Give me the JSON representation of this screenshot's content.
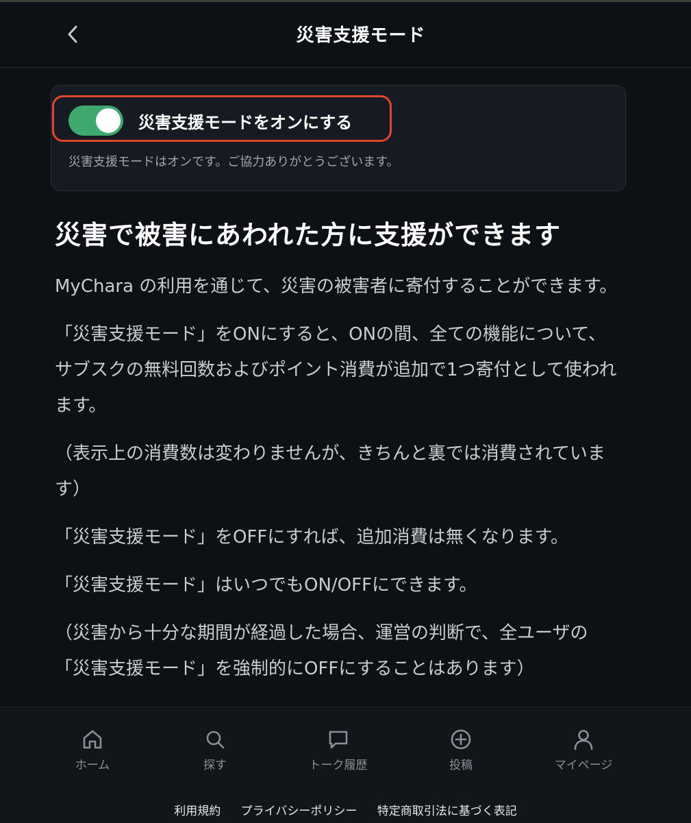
{
  "header": {
    "title": "災害支援モード",
    "back_icon": "chevron-left-icon"
  },
  "toggle_card": {
    "label": "災害支援モードをオンにする",
    "enabled": true,
    "status": "災害支援モードはオンです。ご協力ありがとうございます。",
    "switch_color": "#3ea86f",
    "highlight_color": "#e0452f"
  },
  "main": {
    "heading": "災害で被害にあわれた方に支援ができます",
    "paragraphs": [
      "MyChara の利用を通じて、災害の被害者に寄付することができます。",
      "「災害支援モード」をONにすると、ONの間、全ての機能について、サブスクの無料回数およびポイント消費が追加で1つ寄付として使われます。",
      "（表示上の消費数は変わりませんが、きちんと裏では消費されています）",
      "「災害支援モード」をOFFにすれば、追加消費は無くなります。",
      "「災害支援モード」はいつでもON/OFFにできます。",
      "（災害から十分な期間が経過した場合、運営の判断で、全ユーザの「災害支援モード」を強制的にOFFにすることはあります）"
    ]
  },
  "bottom_nav": {
    "items": [
      {
        "label": "ホーム",
        "icon": "home-icon"
      },
      {
        "label": "探す",
        "icon": "search-icon"
      },
      {
        "label": "トーク履歴",
        "icon": "chat-bubble-icon"
      },
      {
        "label": "投稿",
        "icon": "plus-circle-icon"
      },
      {
        "label": "マイページ",
        "icon": "user-icon"
      }
    ]
  },
  "footer": {
    "links": [
      "利用規約",
      "プライバシーポリシー",
      "特定商取引法に基づく表記"
    ]
  }
}
